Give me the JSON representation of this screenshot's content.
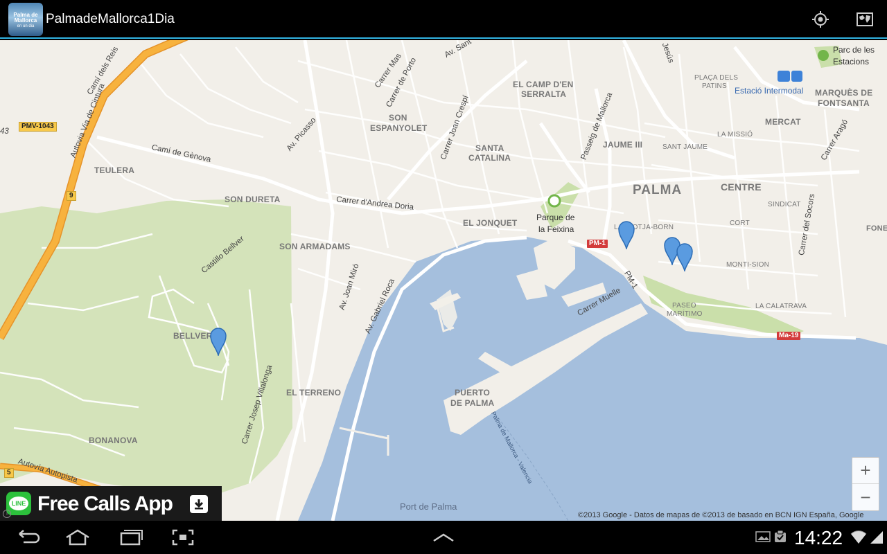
{
  "app": {
    "title": "PalmadeMallorca1Dia",
    "icon_text_1": "Palma de",
    "icon_text_2": "Mallorca",
    "icon_text_3": "en un dia",
    "icons": {
      "locate": "my-location-icon",
      "map_layers": "map-layers-icon"
    }
  },
  "map": {
    "labels": {
      "carrer_mas": "Carrer Mas",
      "carrer_porto": "Carrer de Porto",
      "av_sant": "Av. Sant",
      "el_camp": "EL CAMP D'EN",
      "serralta": "SERRALTA",
      "placa_dels": "PLAÇA DELS",
      "patins": "PATINS",
      "parc_estacions_1": "Parc de les",
      "parc_estacions_2": "Estacions",
      "estacio": "Estació Intermodal",
      "marques_1": "MARQUÈS DE",
      "marques_2": "FONTSANTA",
      "jesus": "Jesús",
      "son_espanyolet_1": "SON",
      "son_espanyolet_2": "ESPANYOLET",
      "carrer_joan_crespi": "Carrer Joan Crespí",
      "av_picasso": "Av. Picasso",
      "santa_catalina_1": "SANTA",
      "santa_catalina_2": "CATALINA",
      "passeig_mallorca": "Passeig de Mallorca",
      "jaume_iii": "JAUME III",
      "sant_jaume": "SANT JAUME",
      "la_missio": "LA MISSIÓ",
      "mercat": "MERCAT",
      "carrer_arago": "Carrer Aragó",
      "cami_reis": "Camí dels Reis",
      "autovia_cintura": "Autovia Via de Cintura",
      "pmv": "PMV-1043",
      "n43": "43",
      "cami_genova": "Camí de Gènova",
      "teulera": "TEULERA",
      "son_dureta": "SON DURETA",
      "carrer_andrea_doria": "Carrer d'Andrea Doria",
      "palma": "PALMA",
      "centre": "CENTRE",
      "sindicat": "SINDICAT",
      "carrer_socors": "Carrer del Socors",
      "parque_feixina_1": "Parque de",
      "parque_feixina_2": "la Feixina",
      "el_jonquet": "EL JONQUET",
      "la_llotja": "LA LLOTJA-BORN",
      "cort": "CORT",
      "pm1": "PM-1",
      "pm1_v": "PM-1",
      "monti_sion": "MONTI-SION",
      "son_armadams": "SON ARMADAMS",
      "castillo_bellver": "Castillo Bellver",
      "av_joan_miro": "Av. Joan Miró",
      "av_gabriel_roca": "Av. Gabriel Roca",
      "carrer_muelle": "Carrer Muelle",
      "paseo_maritimo_1": "PASEO",
      "paseo_maritimo_2": "MARÍTIMO",
      "la_calatrava": "LA CALATRAVA",
      "ma19": "Ma-19",
      "bellver": "BELLVER",
      "el_terreno": "EL TERRENO",
      "puerto_1": "PUERTO",
      "puerto_2": "DE PALMA",
      "carrer_josep_villalonga": "Carrer Josep Villalonga",
      "bonanova": "BONANOVA",
      "ferry_route": "Palma de Mallorca - Valencia",
      "autovia_autopista": "Autovía Autopista",
      "route_9": "9",
      "route_5": "5",
      "port_de_palma": "Port de Palma",
      "fone": "FONE"
    },
    "zoom_in": "+",
    "zoom_out": "−",
    "copyright": "©2013 Google - Datos de mapas de ©2013 de basado en BCN IGN España, Google",
    "colors": {
      "land": "#f2efe9",
      "water": "#a5bfdd",
      "park": "#cadfaa",
      "highway": "#f5a431",
      "marker": "#5a9be0"
    }
  },
  "ad": {
    "logo": "LINE",
    "text": "Free Calls App",
    "info": "i"
  },
  "status": {
    "time": "14:22"
  }
}
